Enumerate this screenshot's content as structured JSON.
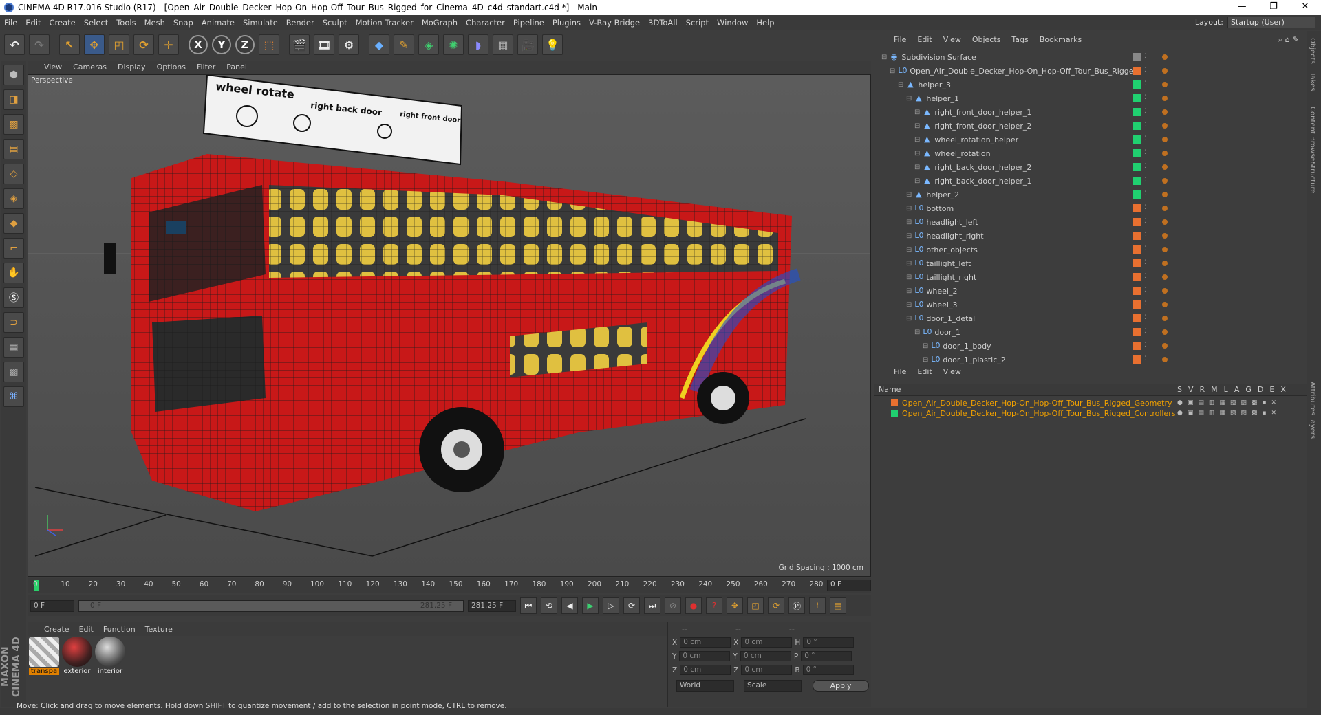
{
  "window": {
    "title": "CINEMA 4D R17.016 Studio (R17) - [Open_Air_Double_Decker_Hop-On_Hop-Off_Tour_Bus_Rigged_for_Cinema_4D_c4d_standart.c4d *] - Main",
    "min": "—",
    "max": "❐",
    "close": "✕"
  },
  "menu": [
    "File",
    "Edit",
    "Create",
    "Select",
    "Tools",
    "Mesh",
    "Snap",
    "Animate",
    "Simulate",
    "Render",
    "Sculpt",
    "Motion Tracker",
    "MoGraph",
    "Character",
    "Pipeline",
    "Plugins",
    "V-Ray Bridge",
    "3DToAll",
    "Script",
    "Window",
    "Help"
  ],
  "layout": {
    "label": "Layout:",
    "value": "Startup (User)"
  },
  "toolbar": {
    "x": "X",
    "y": "Y",
    "z": "Z"
  },
  "viewport": {
    "menu": [
      "View",
      "Cameras",
      "Display",
      "Options",
      "Filter",
      "Panel"
    ],
    "name": "Perspective",
    "grid_spacing": "Grid Spacing : 1000 cm",
    "sign": {
      "title": "wheel rotate",
      "back": "right back door",
      "front": "right front door"
    }
  },
  "timeline": {
    "ticks": [
      "0",
      "10",
      "20",
      "30",
      "40",
      "50",
      "60",
      "70",
      "80",
      "90",
      "100",
      "110",
      "120",
      "130",
      "140",
      "150",
      "160",
      "170",
      "180",
      "190",
      "200",
      "210",
      "220",
      "230",
      "240",
      "250",
      "260",
      "270",
      "280"
    ],
    "current": "0 F"
  },
  "transport": {
    "start": "0 F",
    "range_start": "0 F",
    "range_end": "281.25 F",
    "end": "281.25 F"
  },
  "material_menu": [
    "Create",
    "Edit",
    "Function",
    "Texture"
  ],
  "materials": [
    {
      "name": "transpa"
    },
    {
      "name": "exterior"
    },
    {
      "name": "interior"
    }
  ],
  "coords": {
    "header": [
      "--",
      "--",
      "--"
    ],
    "rows": [
      {
        "a": "X",
        "av": "0 cm",
        "b": "X",
        "bv": "0 cm",
        "c": "H",
        "cv": "0 °"
      },
      {
        "a": "Y",
        "av": "0 cm",
        "b": "Y",
        "bv": "0 cm",
        "c": "P",
        "cv": "0 °"
      },
      {
        "a": "Z",
        "av": "0 cm",
        "b": "Z",
        "bv": "0 cm",
        "c": "B",
        "cv": "0 °"
      }
    ],
    "world": "World",
    "scale": "Scale",
    "apply": "Apply"
  },
  "status": "Move: Click and drag to move elements. Hold down SHIFT to quantize movement / add to the selection in point mode, CTRL to remove.",
  "maxon": "MAXON CINEMA 4D",
  "object_menu": [
    "File",
    "Edit",
    "View",
    "Objects",
    "Tags",
    "Bookmarks"
  ],
  "objects": [
    {
      "name": "Subdivision Surface",
      "indent": 0,
      "color": "#888888"
    },
    {
      "name": "Open_Air_Double_Decker_Hop-On_Hop-Off_Tour_Bus_Rigged",
      "indent": 1,
      "color": "#e87030"
    },
    {
      "name": "helper_3",
      "indent": 2,
      "color": "#20d070"
    },
    {
      "name": "helper_1",
      "indent": 3,
      "color": "#20d070"
    },
    {
      "name": "right_front_door_helper_1",
      "indent": 4,
      "color": "#20d070"
    },
    {
      "name": "right_front_door_helper_2",
      "indent": 4,
      "color": "#20d070"
    },
    {
      "name": "wheel_rotation_helper",
      "indent": 4,
      "color": "#20d070"
    },
    {
      "name": "wheel_rotation",
      "indent": 4,
      "color": "#20d070"
    },
    {
      "name": "right_back_door_helper_2",
      "indent": 4,
      "color": "#20d070"
    },
    {
      "name": "right_back_door_helper_1",
      "indent": 4,
      "color": "#20d070"
    },
    {
      "name": "helper_2",
      "indent": 3,
      "color": "#20d070"
    },
    {
      "name": "bottom",
      "indent": 3,
      "color": "#e87030"
    },
    {
      "name": "headlight_left",
      "indent": 3,
      "color": "#e87030"
    },
    {
      "name": "headlight_right",
      "indent": 3,
      "color": "#e87030"
    },
    {
      "name": "other_objects",
      "indent": 3,
      "color": "#e87030"
    },
    {
      "name": "taillight_left",
      "indent": 3,
      "color": "#e87030"
    },
    {
      "name": "taillight_right",
      "indent": 3,
      "color": "#e87030"
    },
    {
      "name": "wheel_2",
      "indent": 3,
      "color": "#e87030"
    },
    {
      "name": "wheel_3",
      "indent": 3,
      "color": "#e87030"
    },
    {
      "name": "door_1_detal",
      "indent": 3,
      "color": "#e87030"
    },
    {
      "name": "door_1",
      "indent": 4,
      "color": "#e87030"
    },
    {
      "name": "door_1_body",
      "indent": 5,
      "color": "#e87030"
    },
    {
      "name": "door_1_plastic_2",
      "indent": 5,
      "color": "#e87030"
    }
  ],
  "layer_menu": [
    "File",
    "Edit",
    "View"
  ],
  "layer_header": {
    "name": "Name",
    "cols": [
      "S",
      "V",
      "R",
      "M",
      "L",
      "A",
      "G",
      "D",
      "E",
      "X"
    ]
  },
  "layers": [
    {
      "name": "Open_Air_Double_Decker_Hop-On_Hop-Off_Tour_Bus_Rigged_Geometry",
      "color": "#e87030"
    },
    {
      "name": "Open_Air_Double_Decker_Hop-On_Hop-Off_Tour_Bus_Rigged_Controllers",
      "color": "#20d070"
    }
  ],
  "side_tabs": [
    "Objects",
    "Takes",
    "Content Browser",
    "Structure",
    "Attributes",
    "Layers"
  ]
}
